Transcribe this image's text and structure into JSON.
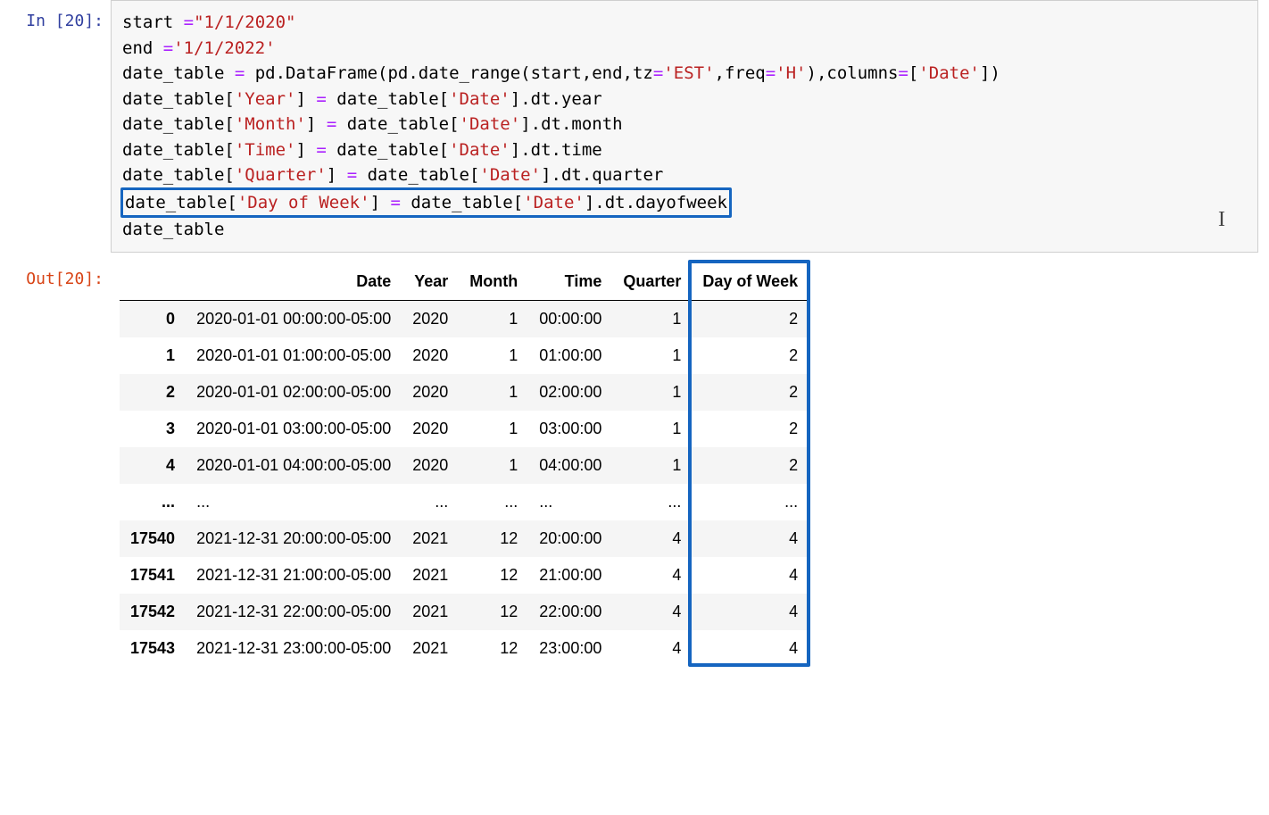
{
  "input_prompt": "In [20]:",
  "output_prompt": "Out[20]:",
  "code": {
    "line1": {
      "a": "start ",
      "op": "=",
      "s": "\"1/1/2020\""
    },
    "line2": {
      "a": "end ",
      "op": "=",
      "s": "'1/1/2022'"
    },
    "line3": {
      "a": "date_table ",
      "op": "=",
      "b": " pd.DataFrame(pd.date_range(start,end,tz",
      "op2": "=",
      "s": "'EST'",
      "c": ",freq",
      "op3": "=",
      "s2": "'H'",
      "d": "),columns",
      "op4": "=",
      "e": "[",
      "s3": "'Date'",
      "f": "])"
    },
    "line4": {
      "a": "date_table[",
      "s": "'Year'",
      "b": "] ",
      "op": "=",
      "c": " date_table[",
      "s2": "'Date'",
      "d": "].dt.year"
    },
    "line5": {
      "a": "date_table[",
      "s": "'Month'",
      "b": "] ",
      "op": "=",
      "c": " date_table[",
      "s2": "'Date'",
      "d": "].dt.month"
    },
    "line6": {
      "a": "date_table[",
      "s": "'Time'",
      "b": "] ",
      "op": "=",
      "c": " date_table[",
      "s2": "'Date'",
      "d": "].dt.time"
    },
    "line7": {
      "a": "date_table[",
      "s": "'Quarter'",
      "b": "] ",
      "op": "=",
      "c": " date_table[",
      "s2": "'Date'",
      "d": "].dt.quarter"
    },
    "line8": {
      "a": "date_table[",
      "s": "'Day of Week'",
      "b": "] ",
      "op": "=",
      "c": " date_table[",
      "s2": "'Date'",
      "d": "].dt.dayofweek"
    },
    "line9": "date_table"
  },
  "table": {
    "columns": [
      "",
      "Date",
      "Year",
      "Month",
      "Time",
      "Quarter",
      "Day of Week"
    ],
    "rows": [
      {
        "idx": "0",
        "date": "2020-01-01 00:00:00-05:00",
        "year": "2020",
        "month": "1",
        "time": "00:00:00",
        "quarter": "1",
        "dow": "2"
      },
      {
        "idx": "1",
        "date": "2020-01-01 01:00:00-05:00",
        "year": "2020",
        "month": "1",
        "time": "01:00:00",
        "quarter": "1",
        "dow": "2"
      },
      {
        "idx": "2",
        "date": "2020-01-01 02:00:00-05:00",
        "year": "2020",
        "month": "1",
        "time": "02:00:00",
        "quarter": "1",
        "dow": "2"
      },
      {
        "idx": "3",
        "date": "2020-01-01 03:00:00-05:00",
        "year": "2020",
        "month": "1",
        "time": "03:00:00",
        "quarter": "1",
        "dow": "2"
      },
      {
        "idx": "4",
        "date": "2020-01-01 04:00:00-05:00",
        "year": "2020",
        "month": "1",
        "time": "04:00:00",
        "quarter": "1",
        "dow": "2"
      },
      {
        "idx": "...",
        "date": "...",
        "year": "...",
        "month": "...",
        "time": "...",
        "quarter": "...",
        "dow": "..."
      },
      {
        "idx": "17540",
        "date": "2021-12-31 20:00:00-05:00",
        "year": "2021",
        "month": "12",
        "time": "20:00:00",
        "quarter": "4",
        "dow": "4"
      },
      {
        "idx": "17541",
        "date": "2021-12-31 21:00:00-05:00",
        "year": "2021",
        "month": "12",
        "time": "21:00:00",
        "quarter": "4",
        "dow": "4"
      },
      {
        "idx": "17542",
        "date": "2021-12-31 22:00:00-05:00",
        "year": "2021",
        "month": "12",
        "time": "22:00:00",
        "quarter": "4",
        "dow": "4"
      },
      {
        "idx": "17543",
        "date": "2021-12-31 23:00:00-05:00",
        "year": "2021",
        "month": "12",
        "time": "23:00:00",
        "quarter": "4",
        "dow": "4"
      }
    ]
  }
}
